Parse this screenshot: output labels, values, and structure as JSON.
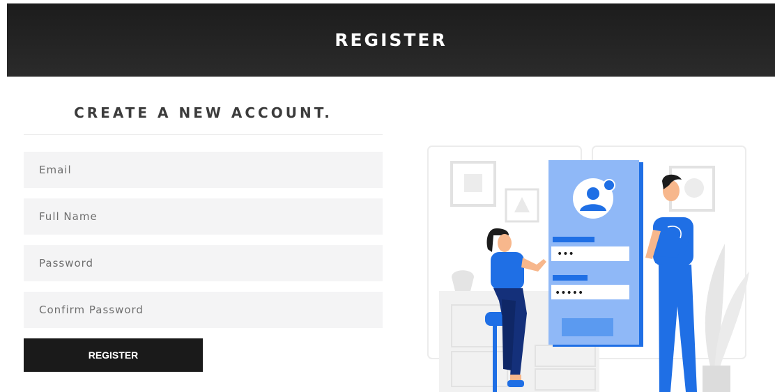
{
  "header": {
    "title": "REGISTER"
  },
  "form": {
    "title": "CREATE A NEW ACCOUNT.",
    "fields": {
      "email": {
        "placeholder": "Email",
        "value": ""
      },
      "full_name": {
        "placeholder": "Full Name",
        "value": ""
      },
      "password": {
        "placeholder": "Password",
        "value": ""
      },
      "confirm_password": {
        "placeholder": "Confirm Password",
        "value": ""
      }
    },
    "submit_label": "REGISTER"
  },
  "illustration": {
    "subject": "people-registering-on-phone",
    "password_masks": [
      "•••",
      "•••••"
    ]
  },
  "colors": {
    "header_bg": "#222222",
    "accent_blue": "#1f6fe5",
    "light_blue": "#8fb8f7",
    "button_bg": "#1a1a1a",
    "field_bg": "#f4f4f5"
  }
}
